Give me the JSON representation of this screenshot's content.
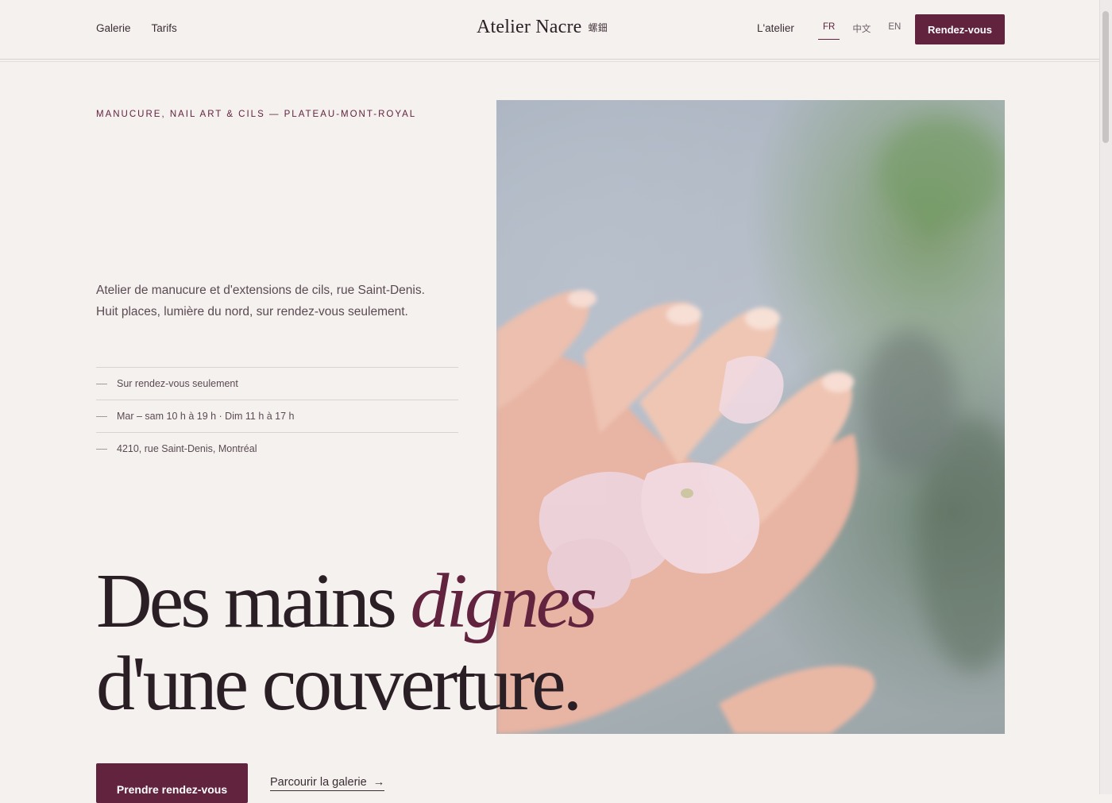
{
  "header": {
    "nav_left": [
      "Galerie",
      "Tarifs"
    ],
    "brand": "Atelier Nacre",
    "brand_cjk": "螺鈿",
    "atelier_link": "L'atelier",
    "languages": [
      "FR",
      "中文",
      "EN"
    ],
    "active_language": "FR",
    "cta": "Rendez-vous"
  },
  "hero": {
    "eyebrow": "MANUCURE, NAIL ART & CILS — PLATEAU-MONT-ROYAL",
    "intro": "Atelier de manucure et d'extensions de cils, rue Saint-Denis. Huit places, lumière du nord, sur rendez-vous seulement.",
    "facts": [
      "Sur rendez-vous seulement",
      "Mar – sam 10 h à 19 h · Dim 11 h à 17 h",
      "4210, rue Saint-Denis, Montréal"
    ],
    "headline_part1": "Des mains ",
    "headline_emphasis": "dignes",
    "headline_line2": "d'une couverture.",
    "primary_cta": "Prendre rendez-vous",
    "secondary_link": "Parcourir la galerie",
    "secondary_arrow": "→"
  },
  "colors": {
    "accent": "#62233f",
    "background": "#f5f1ef",
    "text": "#2b1f26"
  }
}
